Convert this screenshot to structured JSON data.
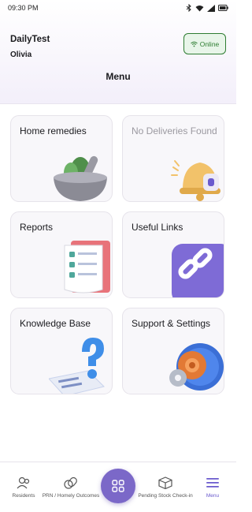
{
  "status_bar": {
    "time": "09:30 PM"
  },
  "header": {
    "app_title": "DailyTest",
    "user_name": "Olivia",
    "status_badge": "Online",
    "page_title": "Menu"
  },
  "menu": {
    "home_remedies": "Home remedies",
    "no_deliveries": "No Deliveries Found",
    "reports": "Reports",
    "useful_links": "Useful Links",
    "knowledge_base": "Knowledge Base",
    "support_settings": "Support & Settings"
  },
  "bottom_nav": {
    "residents": "Residents",
    "prn": "PRN / Homely Outcomes",
    "pending_stock": "Pending Stock Check-in",
    "menu": "Menu"
  },
  "colors": {
    "accent": "#7b68c8",
    "online_green": "#2e7d32",
    "header_tint": "#f3effa"
  },
  "icons": [
    "bluetooth-icon",
    "wifi-icon",
    "signal-icon",
    "battery-icon",
    "residents-icon",
    "pill-icon",
    "grid-icon",
    "box-icon",
    "hamburger-icon"
  ]
}
